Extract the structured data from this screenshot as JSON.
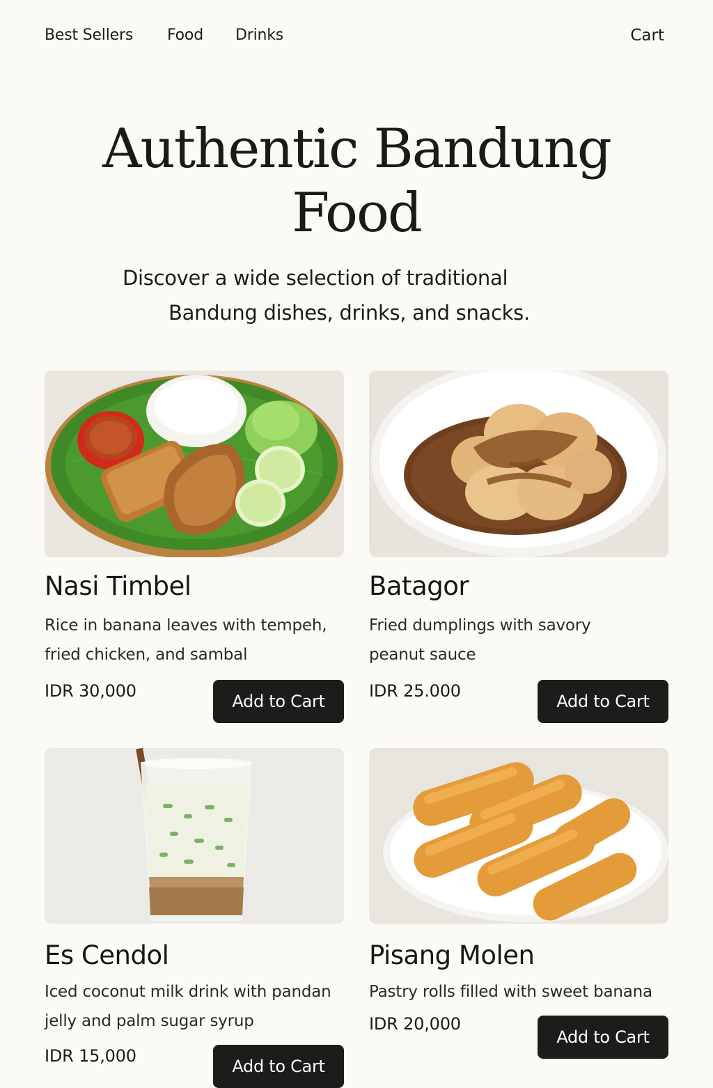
{
  "nav": {
    "links": [
      "Best Sellers",
      "Food",
      "Drinks"
    ],
    "cart_label": "Cart"
  },
  "hero": {
    "title_line1": "Authentic Bandung",
    "title_line2": "Food",
    "subtitle_line1": "Discover a wide selection of traditional",
    "subtitle_line2": "Bandung dishes, drinks, and snacks."
  },
  "products": [
    {
      "name": "Nasi Timbel",
      "desc_line1": "Rice in banana leaves with tempeh,",
      "desc_line2": "fried chicken, and sambal",
      "price": "IDR 30,000",
      "button": "Add to Cart",
      "image": "nasi-timbel-photo"
    },
    {
      "name": "Batagor",
      "desc_line1": "Fried dumplings with savory",
      "desc_line2": "peanut sauce",
      "price": "IDR 25.000",
      "button": "Add to Cart",
      "image": "batagor-photo"
    },
    {
      "name": "Es Cendol",
      "desc_line1": "Iced coconut milk drink with pandan",
      "desc_line2": "jelly and palm sugar syrup",
      "price": "IDR 15,000",
      "button": "Add to Cart",
      "image": "es-cendol-photo"
    },
    {
      "name": "Pisang Molen",
      "desc_line1": "Pastry rolls filled with sweet banana",
      "desc_line2": "",
      "price": "IDR 20,000",
      "button": "Add to Cart",
      "image": "pisang-molen-photo"
    }
  ],
  "colors": {
    "background": "#fcfaf4",
    "text": "#1b1b1a",
    "button": "#1c1c1b",
    "button_text": "#ffffff"
  }
}
